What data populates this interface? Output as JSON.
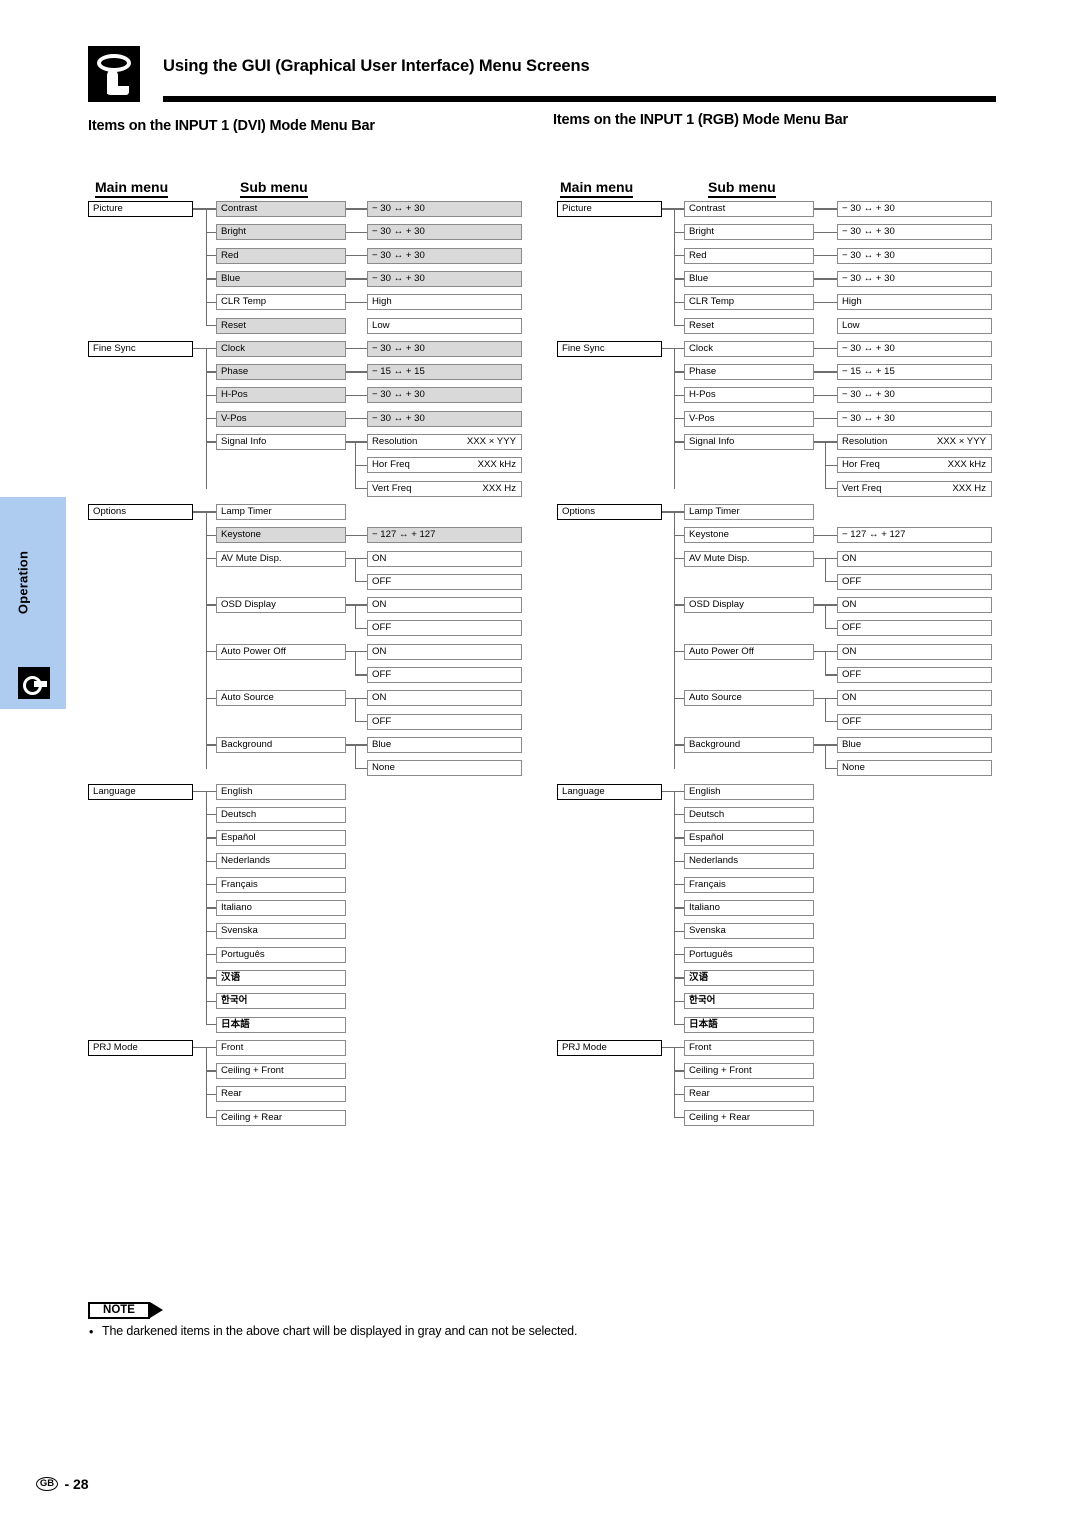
{
  "header": {
    "icon": "press-button-icon",
    "title": "Using the GUI (Graphical User Interface) Menu Screens"
  },
  "side_tab": {
    "label": "Operation",
    "icon": "press-button-icon"
  },
  "columns": [
    {
      "id": "dvi",
      "section_title": "Items on the INPUT 1 (DVI) Mode Menu Bar",
      "head_main": "Main menu",
      "head_sub": "Sub menu",
      "groups": [
        {
          "main": "Picture",
          "rows": [
            {
              "sub": "Contrast",
              "sub_gray": true,
              "val": "− 30 ↔ + 30",
              "val_gray": true
            },
            {
              "sub": "Bright",
              "sub_gray": true,
              "val": "− 30 ↔ + 30",
              "val_gray": true
            },
            {
              "sub": "Red",
              "sub_gray": true,
              "val": "− 30 ↔ + 30",
              "val_gray": true
            },
            {
              "sub": "Blue",
              "sub_gray": true,
              "val": "− 30 ↔ + 30",
              "val_gray": true
            },
            {
              "sub": "CLR Temp",
              "sub_gray": false,
              "val": "High",
              "val_gray": false,
              "branch": true
            },
            {
              "sub": "Reset",
              "sub_gray": true,
              "val": "Low",
              "val_gray": false,
              "branch_end": true
            }
          ]
        },
        {
          "main": "Fine Sync",
          "rows": [
            {
              "sub": "Clock",
              "sub_gray": true,
              "val": "− 30 ↔ + 30",
              "val_gray": true
            },
            {
              "sub": "Phase",
              "sub_gray": true,
              "val": "− 15 ↔ + 15",
              "val_gray": true
            },
            {
              "sub": "H-Pos",
              "sub_gray": true,
              "val": "− 30 ↔ + 30",
              "val_gray": true
            },
            {
              "sub": "V-Pos",
              "sub_gray": true,
              "val": "− 30 ↔ + 30",
              "val_gray": true
            },
            {
              "sub": "Signal Info",
              "sub_gray": false,
              "val": "Resolution",
              "val_right": "XXX × YYY",
              "branch": true
            },
            {
              "sub": "",
              "val": "Hor Freq",
              "val_right": "XXX kHz"
            },
            {
              "sub": "",
              "val": "Vert Freq",
              "val_right": "XXX Hz",
              "branch_end": true
            }
          ]
        },
        {
          "main": "Options",
          "rows": [
            {
              "sub": "Lamp Timer",
              "sub_gray": false,
              "val": ""
            },
            {
              "sub": "Keystone",
              "sub_gray": true,
              "val": "− 127 ↔ + 127",
              "val_gray": true
            },
            {
              "sub": "AV Mute Disp.",
              "sub_gray": false,
              "val": "ON",
              "branch": true
            },
            {
              "sub": "",
              "val": "OFF",
              "branch_end": true
            },
            {
              "sub": "OSD Display",
              "sub_gray": false,
              "val": "ON",
              "branch": true
            },
            {
              "sub": "",
              "val": "OFF",
              "branch_end": true
            },
            {
              "sub": "Auto Power Off",
              "sub_gray": false,
              "val": "ON",
              "branch": true
            },
            {
              "sub": "",
              "val": "OFF",
              "branch_end": true
            },
            {
              "sub": "Auto Source",
              "sub_gray": false,
              "val": "ON",
              "branch": true
            },
            {
              "sub": "",
              "val": "OFF",
              "branch_end": true
            },
            {
              "sub": "Background",
              "sub_gray": false,
              "val": "Blue",
              "branch": true
            },
            {
              "sub": "",
              "val": "None",
              "branch_end": true
            }
          ]
        },
        {
          "main": "Language",
          "rows": [
            {
              "sub": "English"
            },
            {
              "sub": "Deutsch"
            },
            {
              "sub": "Español"
            },
            {
              "sub": "Nederlands"
            },
            {
              "sub": "Français"
            },
            {
              "sub": "Italiano"
            },
            {
              "sub": "Svenska"
            },
            {
              "sub": "Português"
            },
            {
              "sub": "汉语",
              "cjk": true
            },
            {
              "sub": "한국어",
              "cjk": true
            },
            {
              "sub": "日本語",
              "cjk": true
            }
          ]
        },
        {
          "main": "PRJ Mode",
          "rows": [
            {
              "sub": "Front"
            },
            {
              "sub": "Ceiling + Front"
            },
            {
              "sub": "Rear"
            },
            {
              "sub": "Ceiling + Rear"
            }
          ]
        }
      ]
    },
    {
      "id": "rgb",
      "section_title": "Items on the INPUT 1 (RGB) Mode Menu Bar",
      "head_main": "Main menu",
      "head_sub": "Sub menu",
      "groups": [
        {
          "main": "Picture",
          "rows": [
            {
              "sub": "Contrast",
              "val": "− 30 ↔ + 30"
            },
            {
              "sub": "Bright",
              "val": "− 30 ↔ + 30"
            },
            {
              "sub": "Red",
              "val": "− 30 ↔ + 30"
            },
            {
              "sub": "Blue",
              "val": "− 30 ↔ + 30"
            },
            {
              "sub": "CLR Temp",
              "val": "High",
              "branch": true
            },
            {
              "sub": "Reset",
              "val": "Low",
              "branch_end": true
            }
          ]
        },
        {
          "main": "Fine Sync",
          "rows": [
            {
              "sub": "Clock",
              "val": "− 30 ↔ + 30"
            },
            {
              "sub": "Phase",
              "val": "− 15 ↔ + 15"
            },
            {
              "sub": "H-Pos",
              "val": "− 30 ↔ + 30"
            },
            {
              "sub": "V-Pos",
              "val": "− 30 ↔ + 30"
            },
            {
              "sub": "Signal Info",
              "val": "Resolution",
              "val_right": "XXX × YYY",
              "branch": true
            },
            {
              "sub": "",
              "val": "Hor Freq",
              "val_right": "XXX kHz"
            },
            {
              "sub": "",
              "val": "Vert Freq",
              "val_right": "XXX Hz",
              "branch_end": true
            }
          ]
        },
        {
          "main": "Options",
          "rows": [
            {
              "sub": "Lamp Timer",
              "val": ""
            },
            {
              "sub": "Keystone",
              "val": "− 127 ↔ + 127"
            },
            {
              "sub": "AV Mute Disp.",
              "val": "ON",
              "branch": true
            },
            {
              "sub": "",
              "val": "OFF",
              "branch_end": true
            },
            {
              "sub": "OSD Display",
              "val": "ON",
              "branch": true
            },
            {
              "sub": "",
              "val": "OFF",
              "branch_end": true
            },
            {
              "sub": "Auto Power Off",
              "val": "ON",
              "branch": true
            },
            {
              "sub": "",
              "val": "OFF",
              "branch_end": true
            },
            {
              "sub": "Auto Source",
              "val": "ON",
              "branch": true
            },
            {
              "sub": "",
              "val": "OFF",
              "branch_end": true
            },
            {
              "sub": "Background",
              "val": "Blue",
              "branch": true
            },
            {
              "sub": "",
              "val": "None",
              "branch_end": true
            }
          ]
        },
        {
          "main": "Language",
          "rows": [
            {
              "sub": "English"
            },
            {
              "sub": "Deutsch"
            },
            {
              "sub": "Español"
            },
            {
              "sub": "Nederlands"
            },
            {
              "sub": "Français"
            },
            {
              "sub": "Italiano"
            },
            {
              "sub": "Svenska"
            },
            {
              "sub": "Português"
            },
            {
              "sub": "汉语",
              "cjk": true
            },
            {
              "sub": "한국어",
              "cjk": true
            },
            {
              "sub": "日本語",
              "cjk": true
            }
          ]
        },
        {
          "main": "PRJ Mode",
          "rows": [
            {
              "sub": "Front"
            },
            {
              "sub": "Ceiling + Front"
            },
            {
              "sub": "Rear"
            },
            {
              "sub": "Ceiling + Rear"
            }
          ]
        }
      ]
    }
  ],
  "note": {
    "badge": "NOTE",
    "bullet": "•",
    "text": "The darkened items in the above chart will be displayed in gray and can not be selected."
  },
  "footer": {
    "region": "GB",
    "page": "- 28"
  },
  "colors": {
    "tab": "#aecbf0",
    "gray_box": "#d9d9d9",
    "line": "#6e6e6e"
  }
}
